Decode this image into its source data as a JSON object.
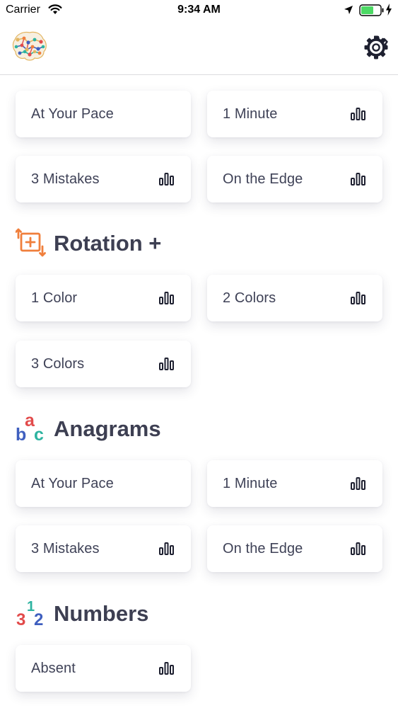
{
  "status_bar": {
    "carrier": "Carrier",
    "time": "9:34 AM",
    "battery_color": "#4cd964"
  },
  "colors": {
    "text": "#3d3f52",
    "rotation_icon": "#f07f3c",
    "numbers_3": "#e24b4b",
    "numbers_1": "#2db3a0",
    "numbers_2": "#3f5fbf"
  },
  "header": {
    "logo_icon": "brain-icon",
    "settings_icon": "gear-icon"
  },
  "sections": [
    {
      "title": "",
      "cards": [
        {
          "label": "At Your Pace",
          "stats": false
        },
        {
          "label": "1 Minute",
          "stats": true
        },
        {
          "label": "3 Mistakes",
          "stats": true
        },
        {
          "label": "On the Edge",
          "stats": true
        }
      ]
    },
    {
      "title": "Rotation +",
      "icon": "rotation-plus-icon",
      "cards": [
        {
          "label": "1 Color",
          "stats": true
        },
        {
          "label": "2 Colors",
          "stats": true
        },
        {
          "label": "3 Colors",
          "stats": true
        }
      ]
    },
    {
      "title": "Anagrams",
      "icon": "abc-icon",
      "icon_letters": [
        "b",
        "a",
        "c"
      ],
      "cards": [
        {
          "label": "At Your Pace",
          "stats": false
        },
        {
          "label": "1 Minute",
          "stats": true
        },
        {
          "label": "3 Mistakes",
          "stats": true
        },
        {
          "label": "On the Edge",
          "stats": true
        }
      ]
    },
    {
      "title": "Numbers",
      "icon": "numbers-icon",
      "icon_digits": [
        "3",
        "1",
        "2"
      ],
      "cards": [
        {
          "label": "Absent",
          "stats": true
        }
      ]
    }
  ]
}
